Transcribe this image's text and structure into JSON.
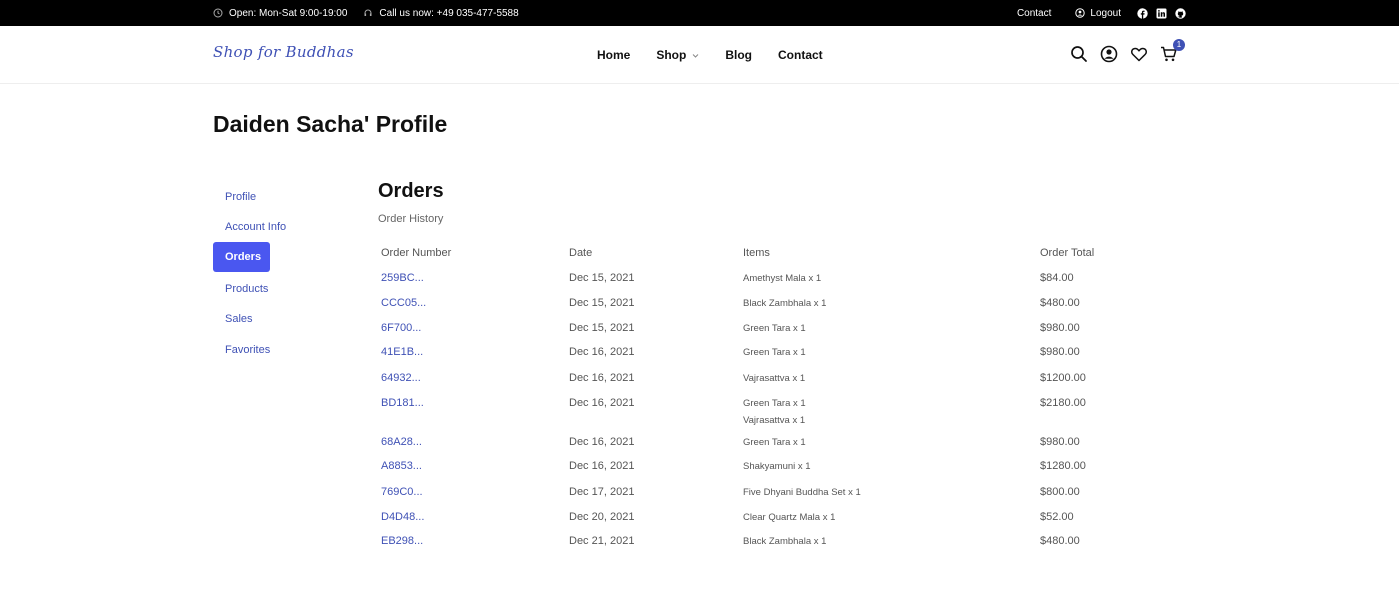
{
  "topbar": {
    "hours": "Open: Mon-Sat 9:00-19:00",
    "phone": "Call us now: +49 035-477-5588",
    "contact": "Contact",
    "logout": "Logout"
  },
  "header": {
    "logo": "Shop for Buddhas",
    "nav": [
      "Home",
      "Shop",
      "Blog",
      "Contact"
    ],
    "cart_count": "1"
  },
  "page": {
    "title": "Daiden Sacha' Profile"
  },
  "sidebar": {
    "items": [
      "Profile",
      "Account Info",
      "Orders",
      "Products",
      "Sales",
      "Favorites"
    ],
    "active": "Orders"
  },
  "orders": {
    "title": "Orders",
    "subtitle": "Order History",
    "columns": [
      "Order Number",
      "Date",
      "Items",
      "Order Total"
    ],
    "rows": [
      {
        "number": "259BC...",
        "date": "Dec 15, 2021",
        "items": [
          "Amethyst Mala x 1"
        ],
        "total": "$84.00"
      },
      {
        "number": "CCC05...",
        "date": "Dec 15, 2021",
        "items": [
          "Black Zambhala x 1"
        ],
        "total": "$480.00"
      },
      {
        "number": "6F700...",
        "date": "Dec 15, 2021",
        "items": [
          "Green Tara x 1"
        ],
        "total": "$980.00"
      },
      {
        "number": "41E1B...",
        "date": "Dec 16, 2021",
        "items": [
          "Green Tara x 1"
        ],
        "total": "$980.00"
      },
      {
        "number": "64932...",
        "date": "Dec 16, 2021",
        "items": [
          "Vajrasattva x 1"
        ],
        "total": "$1200.00"
      },
      {
        "number": "BD181...",
        "date": "Dec 16, 2021",
        "items": [
          "Green Tara x 1",
          "Vajrasattva x 1"
        ],
        "total": "$2180.00"
      },
      {
        "number": "68A28...",
        "date": "Dec 16, 2021",
        "items": [
          "Green Tara x 1"
        ],
        "total": "$980.00"
      },
      {
        "number": "A8853...",
        "date": "Dec 16, 2021",
        "items": [
          "Shakyamuni x 1"
        ],
        "total": "$1280.00"
      },
      {
        "number": "769C0...",
        "date": "Dec 17, 2021",
        "items": [
          "Five Dhyani Buddha Set x 1"
        ],
        "total": "$800.00"
      },
      {
        "number": "D4D48...",
        "date": "Dec 20, 2021",
        "items": [
          "Clear Quartz Mala x 1"
        ],
        "total": "$52.00"
      },
      {
        "number": "EB298...",
        "date": "Dec 21, 2021",
        "items": [
          "Black Zambhala x 1"
        ],
        "total": "$480.00"
      }
    ]
  },
  "colors": {
    "accent": "#4a57f0",
    "link": "#3f51b5",
    "topbar_bg": "#000000"
  }
}
